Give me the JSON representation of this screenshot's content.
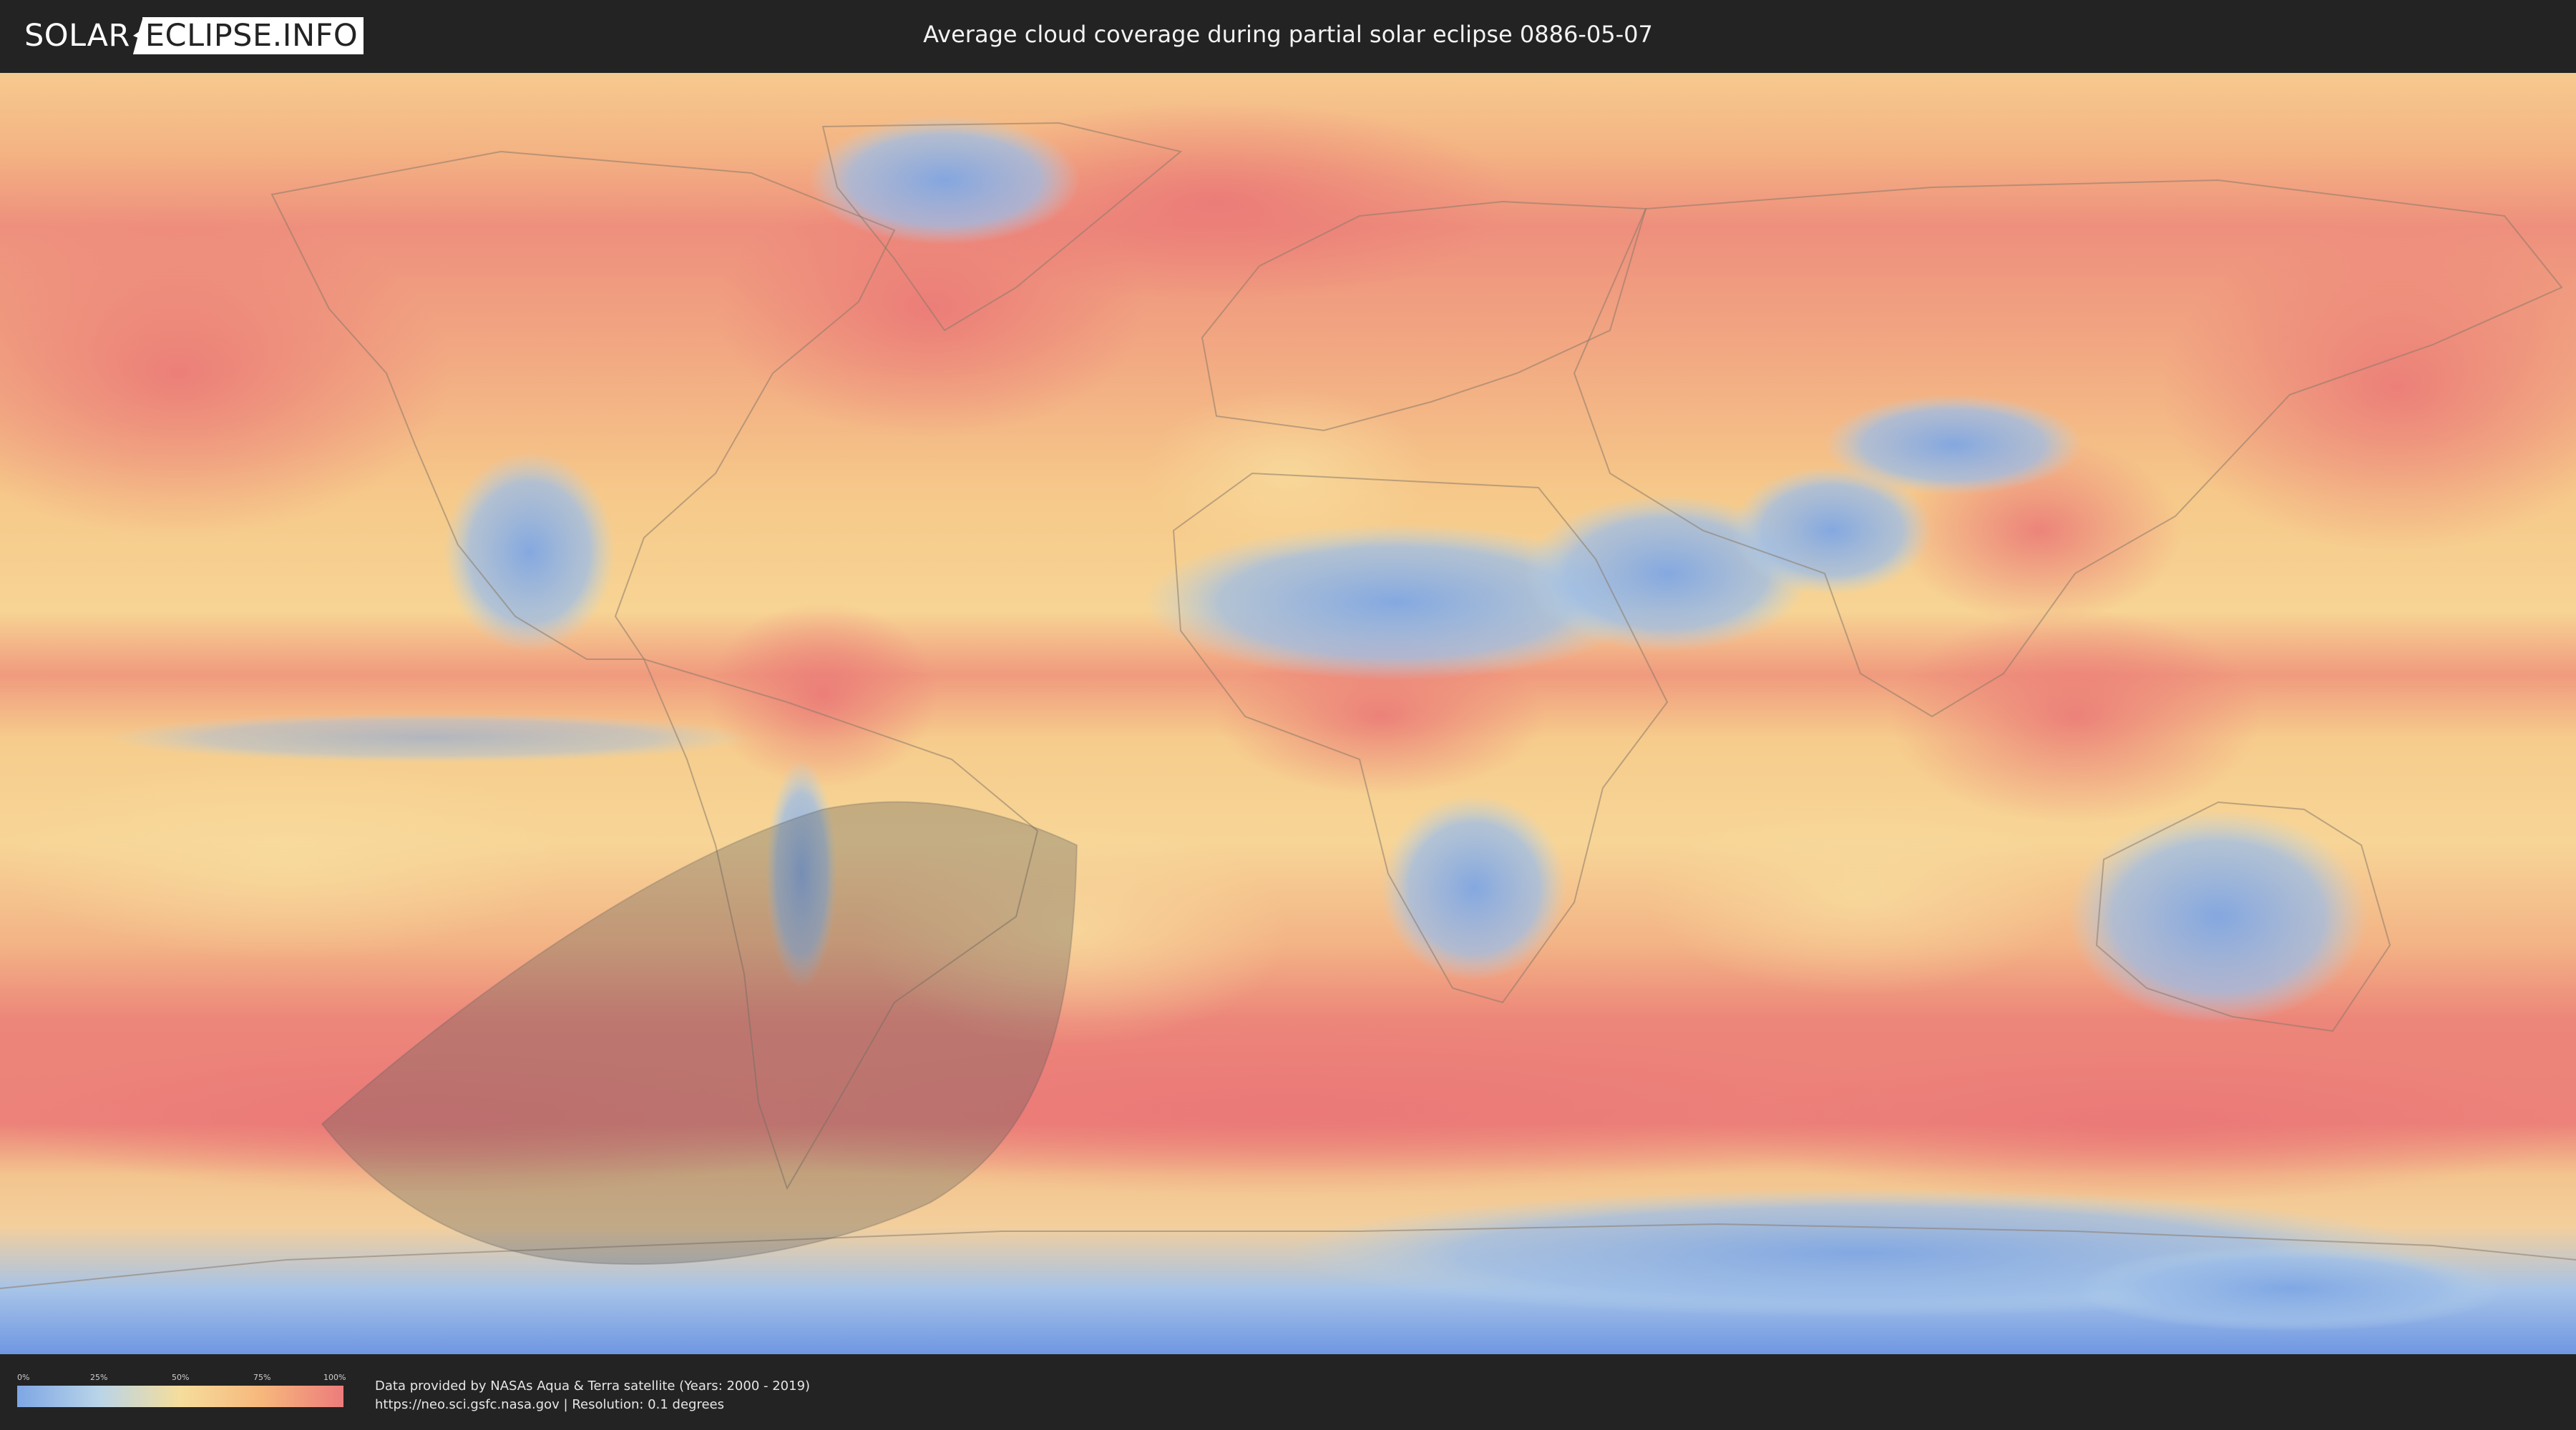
{
  "header": {
    "logo_left": "SOLAR",
    "logo_right": "ECLIPSE.INFO",
    "title": "Average cloud coverage during partial solar eclipse 0886-05-07"
  },
  "map": {
    "layer": "average cloud coverage",
    "icons": {
      "eclipse_zone": "shaded-eclipse-region",
      "borders": "country-borders"
    },
    "colors": {
      "low": "#7ea6e4",
      "mid_low": "#b9d4e8",
      "mid": "#f5dd9c",
      "mid_high": "#f7b77c",
      "high": "#ec7c7c",
      "eclipse_shade": "#5a5a5a"
    }
  },
  "legend": {
    "ticks": [
      "0%",
      "25%",
      "50%",
      "75%",
      "100%"
    ]
  },
  "footer": {
    "credit_line1": "Data provided by NASAs Aqua & Terra satellite (Years: 2000 - 2019)",
    "credit_line2": "https://neo.sci.gsfc.nasa.gov | Resolution: 0.1 degrees"
  }
}
